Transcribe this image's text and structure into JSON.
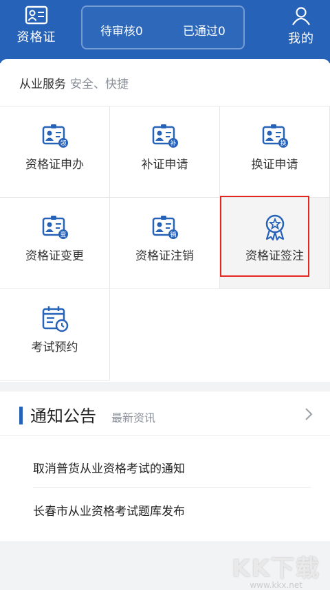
{
  "header": {
    "left_label": "资格证",
    "pending": "待审核0",
    "passed": "已通过0",
    "right_label": "我的"
  },
  "services": {
    "title": "从业服务",
    "subtitle": "安全、快捷",
    "items": [
      {
        "label": "资格证申办",
        "badge": "领"
      },
      {
        "label": "补证申请",
        "badge": "补"
      },
      {
        "label": "换证申请",
        "badge": "换"
      },
      {
        "label": "资格证变更",
        "badge": "变"
      },
      {
        "label": "资格证注销",
        "badge": "销"
      },
      {
        "label": "资格证签注"
      },
      {
        "label": "考试预约"
      }
    ]
  },
  "notice": {
    "title": "通知公告",
    "subtitle": "最新资讯",
    "items": [
      "取消普货从业资格考试的通知",
      "长春市从业资格考试题库发布"
    ]
  },
  "watermark": {
    "big": "KK下载",
    "small": "www.kkx.net"
  },
  "colors": {
    "primary": "#2662b8",
    "highlight": "#e52620"
  }
}
